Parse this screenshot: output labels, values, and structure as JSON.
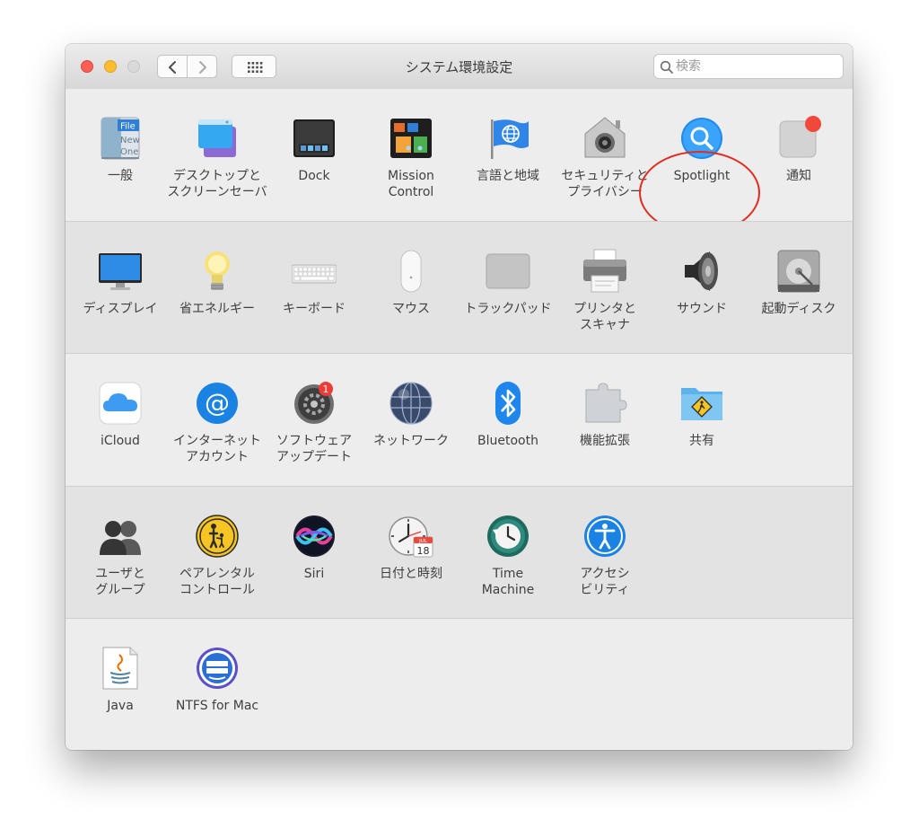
{
  "window": {
    "title": "システム環境設定",
    "search": {
      "placeholder": "検索",
      "value": ""
    }
  },
  "highlight_color": "#e22b21",
  "rows": [
    [
      {
        "label": "一般",
        "icon": "general-icon"
      },
      {
        "label": "デスクトップと\nスクリーンセーバ",
        "icon": "desktop-screensaver-icon"
      },
      {
        "label": "Dock",
        "icon": "dock-icon"
      },
      {
        "label": "Mission\nControl",
        "icon": "mission-control-icon"
      },
      {
        "label": "言語と地域",
        "icon": "language-region-icon"
      },
      {
        "label": "セキュリティと\nプライバシー",
        "icon": "security-privacy-icon"
      },
      {
        "label": "Spotlight",
        "icon": "spotlight-icon"
      },
      {
        "label": "通知",
        "icon": "notifications-icon"
      }
    ],
    [
      {
        "label": "ディスプレイ",
        "icon": "displays-icon"
      },
      {
        "label": "省エネルギー",
        "icon": "energy-saver-icon"
      },
      {
        "label": "キーボード",
        "icon": "keyboard-icon"
      },
      {
        "label": "マウス",
        "icon": "mouse-icon"
      },
      {
        "label": "トラックパッド",
        "icon": "trackpad-icon"
      },
      {
        "label": "プリンタと\nスキャナ",
        "icon": "printers-scanners-icon"
      },
      {
        "label": "サウンド",
        "icon": "sound-icon"
      },
      {
        "label": "起動ディスク",
        "icon": "startup-disk-icon"
      }
    ],
    [
      {
        "label": "iCloud",
        "icon": "icloud-icon"
      },
      {
        "label": "インターネット\nアカウント",
        "icon": "internet-accounts-icon"
      },
      {
        "label": "ソフトウェア\nアップデート",
        "icon": "software-update-icon",
        "badge": "1"
      },
      {
        "label": "ネットワーク",
        "icon": "network-icon"
      },
      {
        "label": "Bluetooth",
        "icon": "bluetooth-icon"
      },
      {
        "label": "機能拡張",
        "icon": "extensions-icon"
      },
      {
        "label": "共有",
        "icon": "sharing-icon"
      }
    ],
    [
      {
        "label": "ユーザと\nグループ",
        "icon": "users-groups-icon"
      },
      {
        "label": "ペアレンタル\nコントロール",
        "icon": "parental-controls-icon"
      },
      {
        "label": "Siri",
        "icon": "siri-icon"
      },
      {
        "label": "日付と時刻",
        "icon": "date-time-icon",
        "month": "JUL",
        "day": "18"
      },
      {
        "label": "Time\nMachine",
        "icon": "time-machine-icon"
      },
      {
        "label": "アクセシ\nビリティ",
        "icon": "accessibility-icon"
      }
    ],
    [
      {
        "label": "Java",
        "icon": "java-icon"
      },
      {
        "label": "NTFS for Mac",
        "icon": "ntfs-for-mac-icon"
      }
    ]
  ]
}
